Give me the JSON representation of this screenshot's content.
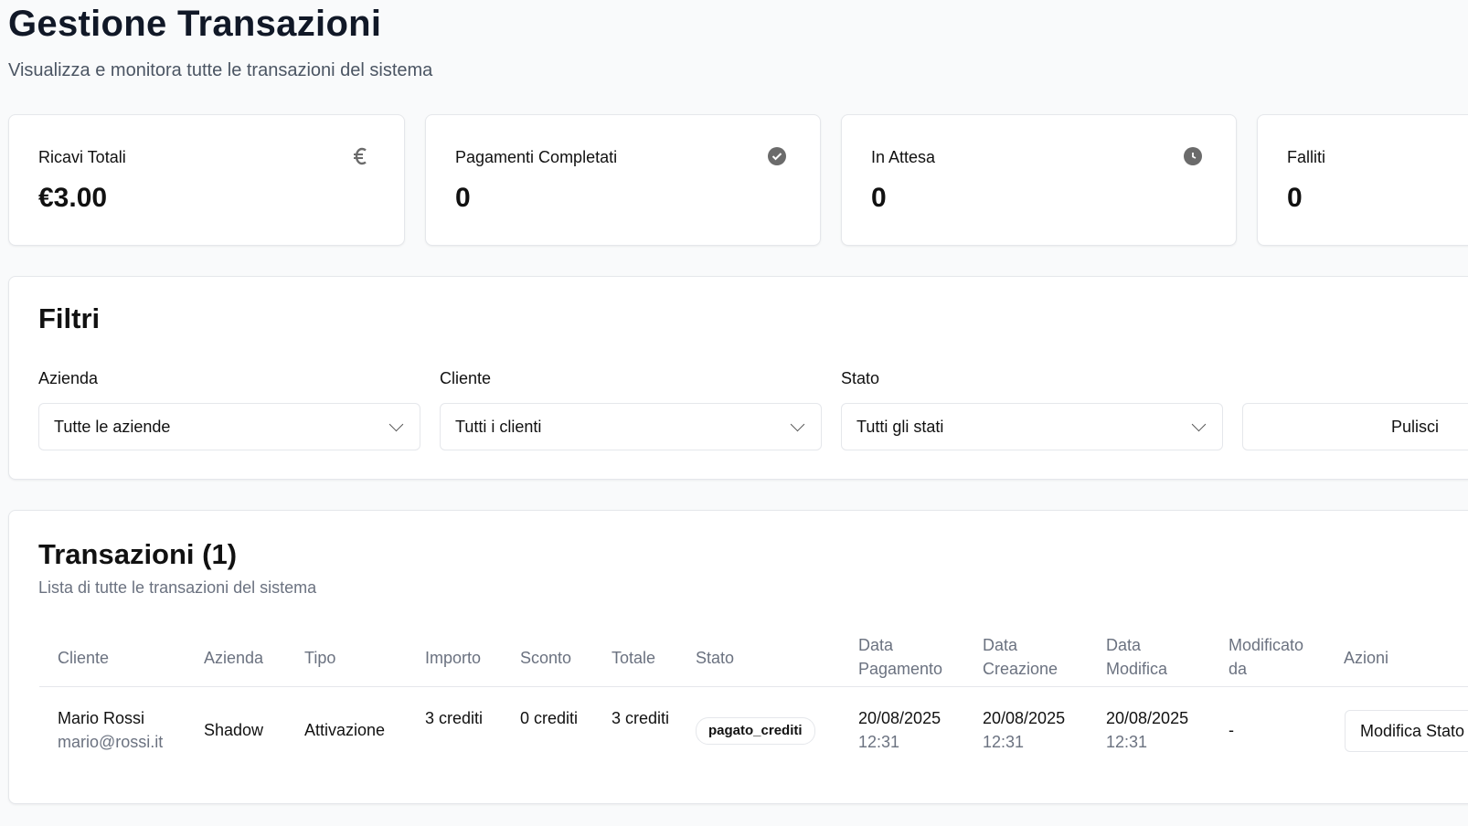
{
  "header": {
    "title": "Gestione Transazioni",
    "subtitle": "Visualizza e monitora tutte le transazioni del sistema"
  },
  "stats": [
    {
      "label": "Ricavi Totali",
      "value": "€3.00",
      "icon": "euro-icon"
    },
    {
      "label": "Pagamenti Completati",
      "value": "0",
      "icon": "check-circle-icon"
    },
    {
      "label": "In Attesa",
      "value": "0",
      "icon": "clock-icon"
    },
    {
      "label": "Falliti",
      "value": "0",
      "icon": ""
    }
  ],
  "filters": {
    "title": "Filtri",
    "azienda": {
      "label": "Azienda",
      "value": "Tutte le aziende"
    },
    "cliente": {
      "label": "Cliente",
      "value": "Tutti i clienti"
    },
    "stato": {
      "label": "Stato",
      "value": "Tutti gli stati"
    },
    "clear_label": "Pulisci"
  },
  "transactions": {
    "title": "Transazioni (1)",
    "description": "Lista di tutte le transazioni del sistema",
    "columns": {
      "cliente": "Cliente",
      "azienda": "Azienda",
      "tipo": "Tipo",
      "importo": "Importo",
      "sconto": "Sconto",
      "totale": "Totale",
      "stato": "Stato",
      "data_pagamento": "Data Pagamento",
      "data_creazione": "Data Creazione",
      "data_modifica": "Data Modifica",
      "modificato_da": "Modificato da",
      "azioni": "Azioni"
    },
    "rows": [
      {
        "cliente_name": "Mario Rossi",
        "cliente_email": "mario@rossi.it",
        "azienda": "Shadow",
        "tipo": "Attivazione",
        "importo": "3 crediti",
        "sconto": "0 crediti",
        "totale": "3 crediti",
        "stato": "pagato_crediti",
        "data_pagamento_date": "20/08/2025",
        "data_pagamento_time": "12:31",
        "data_creazione_date": "20/08/2025",
        "data_creazione_time": "12:31",
        "data_modifica_date": "20/08/2025",
        "data_modifica_time": "12:31",
        "modificato_da": "-",
        "action_label": "Modifica Stato"
      }
    ]
  },
  "colors": {
    "background": "#f9fafb",
    "card": "#ffffff",
    "border": "#e5e7eb",
    "muted_text": "#6b7280",
    "icon": "#6b6b6b"
  }
}
